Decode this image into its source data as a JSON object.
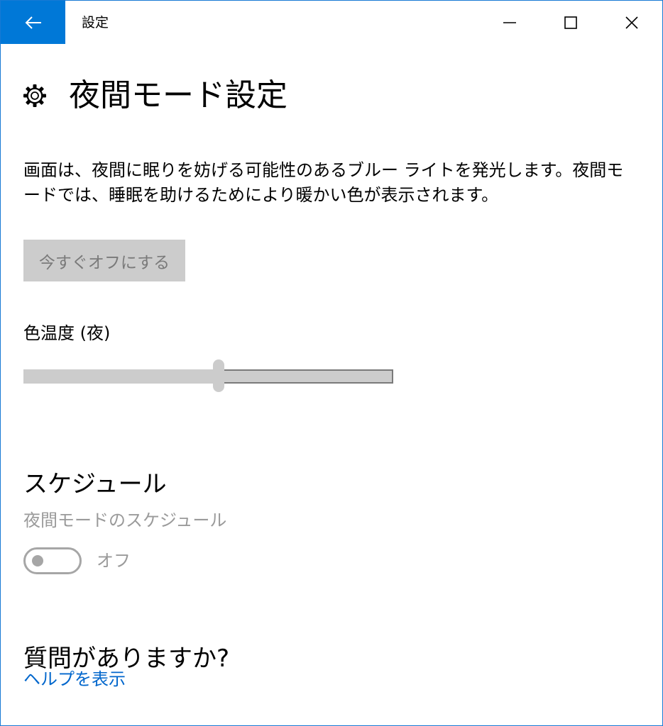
{
  "window": {
    "title": "設定",
    "accent_color": "#0078d7"
  },
  "icons": {
    "back": "arrow-left-icon",
    "minimize": "minimize-icon",
    "maximize": "maximize-icon",
    "close": "close-icon",
    "page": "gear-icon"
  },
  "page": {
    "title": "夜間モード設定",
    "description": "画面は、夜間に眠りを妨げる可能性のあるブルー ライトを発光します。夜間モードでは、睡眠を助けるためにより暖かい色が表示されます。",
    "turn_off_button": "今すぐオフにする",
    "color_temperature": {
      "label": "色温度 (夜)",
      "value_fraction": 0.527
    },
    "schedule": {
      "heading": "スケジュール",
      "label": "夜間モードのスケジュール",
      "toggle_state": "オフ",
      "toggle_on": false
    },
    "help": {
      "heading": "質問がありますか?",
      "link": "ヘルプを表示"
    }
  }
}
